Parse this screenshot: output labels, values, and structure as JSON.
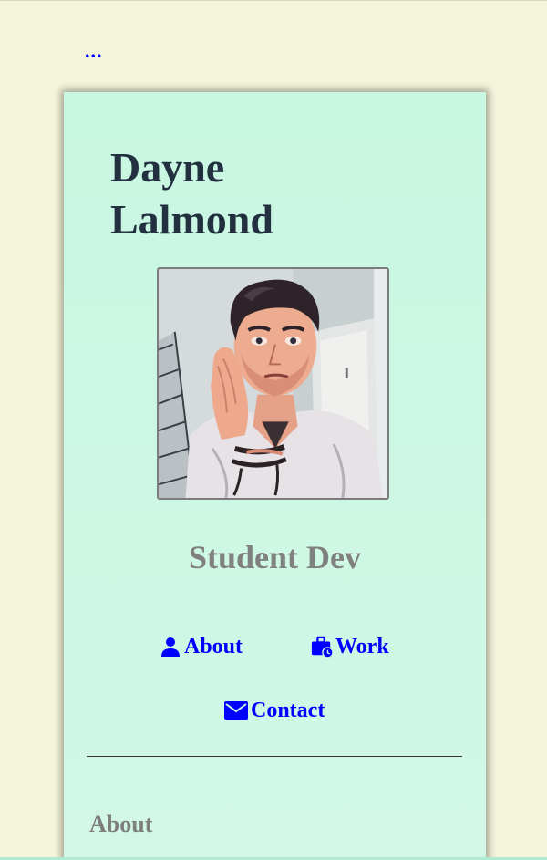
{
  "menu": {
    "label": "...",
    "icon": "more-dots-icon"
  },
  "profile": {
    "name_line1": "Dayne",
    "name_line2": "Lalmond",
    "photo_alt": "Profile photo",
    "subtitle": "Student Dev"
  },
  "nav": {
    "about_label": "About",
    "about_icon": "person-icon",
    "work_label": "Work",
    "work_icon": "briefcase-clock-icon",
    "contact_label": "Contact",
    "contact_icon": "mail-icon"
  },
  "sections": {
    "about_heading": "About"
  },
  "colors": {
    "page_bg": "#f5f5dc",
    "card_bg": "#c8f7e2",
    "link": "#0000ff",
    "name": "#22303f",
    "muted": "#808080"
  }
}
